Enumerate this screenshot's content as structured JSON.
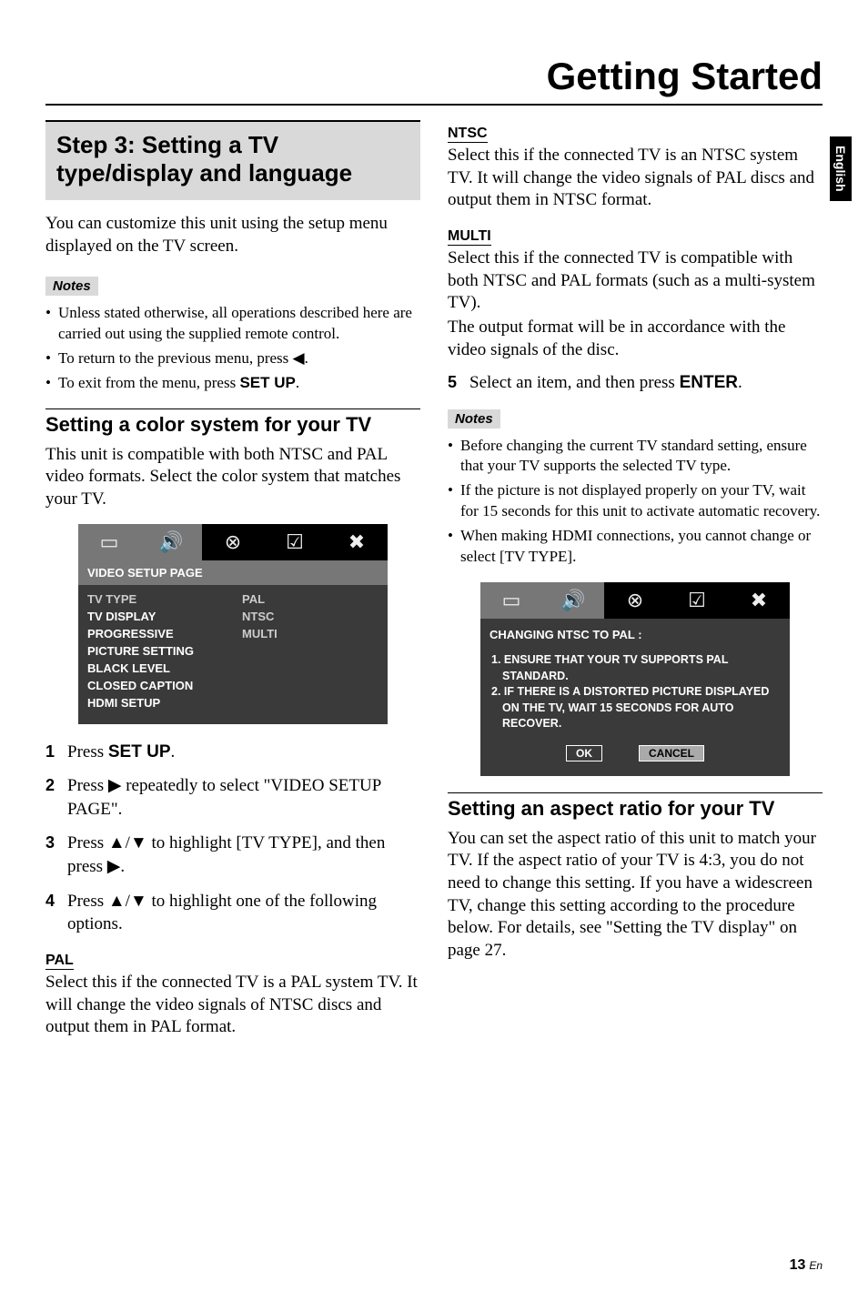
{
  "page_title": "Getting Started",
  "side_tab": "English",
  "step_heading": "Step 3: Setting a TV type/display and language",
  "intro": "You can customize this unit using the setup menu displayed on the TV screen.",
  "notes_label": "Notes",
  "notes1": [
    "Unless stated otherwise, all operations described here are carried out using the supplied remote control.",
    "To return to the previous menu, press ◀.",
    "To exit from the menu, press SET UP."
  ],
  "section_color": "Setting a color system for your TV",
  "color_body": "This unit is compatible with both NTSC and PAL video formats. Select the color system that matches your TV.",
  "panel1": {
    "sub": "VIDEO SETUP PAGE",
    "rows": [
      {
        "l": "TV TYPE",
        "r": "PAL",
        "hl": true
      },
      {
        "l": "TV DISPLAY",
        "r": "NTSC"
      },
      {
        "l": "PROGRESSIVE",
        "r": "MULTI"
      },
      {
        "l": "PICTURE SETTING",
        "r": ""
      },
      {
        "l": "BLACK LEVEL",
        "r": ""
      },
      {
        "l": "CLOSED CAPTION",
        "r": ""
      },
      {
        "l": "HDMI SETUP",
        "r": ""
      }
    ]
  },
  "steps": [
    "Press SET UP.",
    "Press ▶ repeatedly to select \"VIDEO SETUP PAGE\".",
    "Press ▲/▼ to highlight [TV TYPE], and then press ▶.",
    "Press ▲/▼ to highlight one of the following options."
  ],
  "opt_pal_head": "PAL",
  "opt_pal_body": "Select this if the connected TV is a PAL system TV. It will change the video signals of NTSC discs and output them in PAL format.",
  "opt_ntsc_head": "NTSC",
  "opt_ntsc_body": "Select this if the connected TV is an NTSC system TV. It will change the video signals of PAL discs and output them in NTSC format.",
  "opt_multi_head": "MULTI",
  "opt_multi_body1": "Select this if the connected TV is compatible with both NTSC and PAL formats (such as a multi-system TV).",
  "opt_multi_body2": "The output format will be in accordance with the video signals of the disc.",
  "step5": "Select an item, and then press ENTER.",
  "notes2": [
    "Before changing the current TV standard setting, ensure that your TV supports the selected TV type.",
    "If the picture is not displayed properly on your TV, wait for 15 seconds for this unit to activate automatic recovery.",
    "When making HDMI connections, you cannot change or select [TV TYPE]."
  ],
  "panel2": {
    "sub": "CHANGING NTSC TO PAL :",
    "msg1": "1. ENSURE THAT YOUR TV SUPPORTS PAL STANDARD.",
    "msg2": "2. IF THERE IS A DISTORTED PICTURE DISPLAYED ON THE TV, WAIT 15 SECONDS FOR AUTO RECOVER.",
    "ok": "OK",
    "cancel": "CANCEL"
  },
  "section_aspect": "Setting an aspect ratio for your TV",
  "aspect_body": "You can set the aspect ratio of this unit to match your TV. If the aspect ratio of your TV is 4:3, you do not need to change this setting. If you have a widescreen TV, change this setting according to the procedure below. For details, see \"Setting the TV display\" on page 27.",
  "footer_num": "13",
  "footer_lang": "En"
}
